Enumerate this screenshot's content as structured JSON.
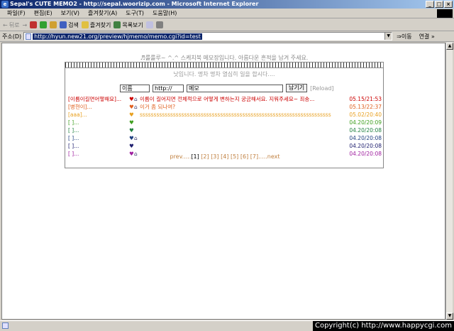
{
  "window": {
    "title": "Sepal's CUTE MEMO2 - http://sepal.woorizip.com - Microsoft Internet Explorer"
  },
  "menu": [
    "파일(F)",
    "편집(E)",
    "보기(V)",
    "즐겨찾기(A)",
    "도구(T)",
    "도움말(H)"
  ],
  "toolbar": {
    "back": "뒤로",
    "search": "검색",
    "favorites": "즐겨찾기",
    "history": "목록보기"
  },
  "address": {
    "label": "주소(D)",
    "url": "http://hyun.new21.org/preview/hjmemo/memo.cgi?id=test",
    "go": "이동",
    "links": "연결 »"
  },
  "page": {
    "title": "♬룰룰루~ ^.^ 스케치북 메모장입니다. 아름다운 흔적을 남겨 주세요.",
    "subtitle": "낫입니다. 명차 명차 열심히 일을 합시다....",
    "form": {
      "name": "이름",
      "url": "http://",
      "memo": "메모",
      "submit": "남기기",
      "reload": "[Reload]"
    },
    "rows": [
      {
        "name": "[이름이길면어떻해요]...",
        "msg": "이름이 길어지면 전체적으로 어떻게 변하는지 궁금해서요. 지워주세요~ 죄송...",
        "date": "05.15/21:53",
        "color": "#cc0000",
        "home": true
      },
      {
        "name": "[병현이]...",
        "msg": "이거 좀 되나여?",
        "date": "05.13/22:37",
        "color": "#e06020",
        "home": true
      },
      {
        "name": "[aaa]...",
        "msg": "ssssssssssssssssssssssssssssssssssssssssssssssssssssssssssssssssssssssssssssssssssssssssss",
        "date": "05.02/20:40",
        "color": "#e8a020",
        "home": false
      },
      {
        "name": "[ ]...",
        "msg": "",
        "date": "04.20/20:09",
        "color": "#40a020",
        "home": false
      },
      {
        "name": "[ ]...",
        "msg": "",
        "date": "04.20/20:08",
        "color": "#208040",
        "home": false
      },
      {
        "name": "[ ]...",
        "msg": "",
        "date": "04.20/20:08",
        "color": "#204080",
        "home": true
      },
      {
        "name": "[ ]...",
        "msg": "",
        "date": "04.20/20:08",
        "color": "#202070",
        "home": false
      },
      {
        "name": "[ ]...",
        "msg": "",
        "date": "04.20/20:08",
        "color": "#a020a0",
        "home": true
      }
    ],
    "pager": {
      "prev": "prev.....",
      "pages": [
        "[1]",
        "[2]",
        "[3]",
        "[4]",
        "[5]",
        "[6]",
        "[7]"
      ],
      "next": ".....next"
    }
  },
  "status": {
    "copyright": "Copyright(c) http://www.happycgi.com"
  }
}
